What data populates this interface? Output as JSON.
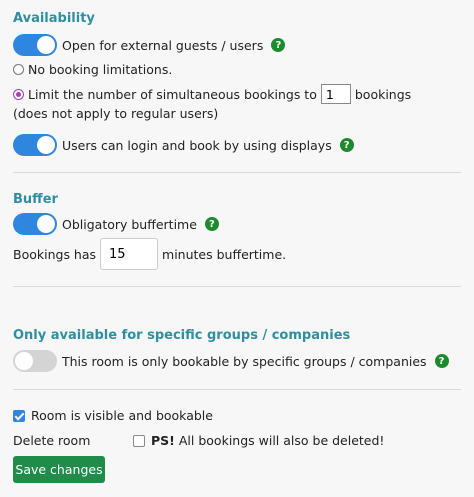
{
  "availability": {
    "title": "Availability",
    "external_guests_label": "Open for external guests / users",
    "no_limit_label": "No booking limitations.",
    "limit_label": "Limit the number of simultaneous bookings to",
    "limit_value": "1",
    "limit_suffix": "bookings",
    "limit_note": "(does not apply to regular users)",
    "displays_label": "Users can login and book by using displays"
  },
  "buffer": {
    "title": "Buffer",
    "obligatory_label": "Obligatory buffertime",
    "bookings_has_label": "Bookings has",
    "buffer_value": "15",
    "buffer_suffix": "minutes buffertime."
  },
  "groups": {
    "title": "Only available for specific groups / companies",
    "restrict_label": "This room is only bookable by specific groups / companies"
  },
  "room": {
    "visible_label": "Room is visible and bookable",
    "delete_label": "Delete room",
    "delete_warning_bold": "PS!",
    "delete_warning_text": "All bookings will also be deleted!",
    "save_label": "Save changes"
  },
  "help_glyph": "?",
  "colors": {
    "section_title": "#2f8fa0",
    "toggle_on": "#2f86de",
    "help": "#1e8a2e",
    "save_button": "#1f8c4a"
  }
}
